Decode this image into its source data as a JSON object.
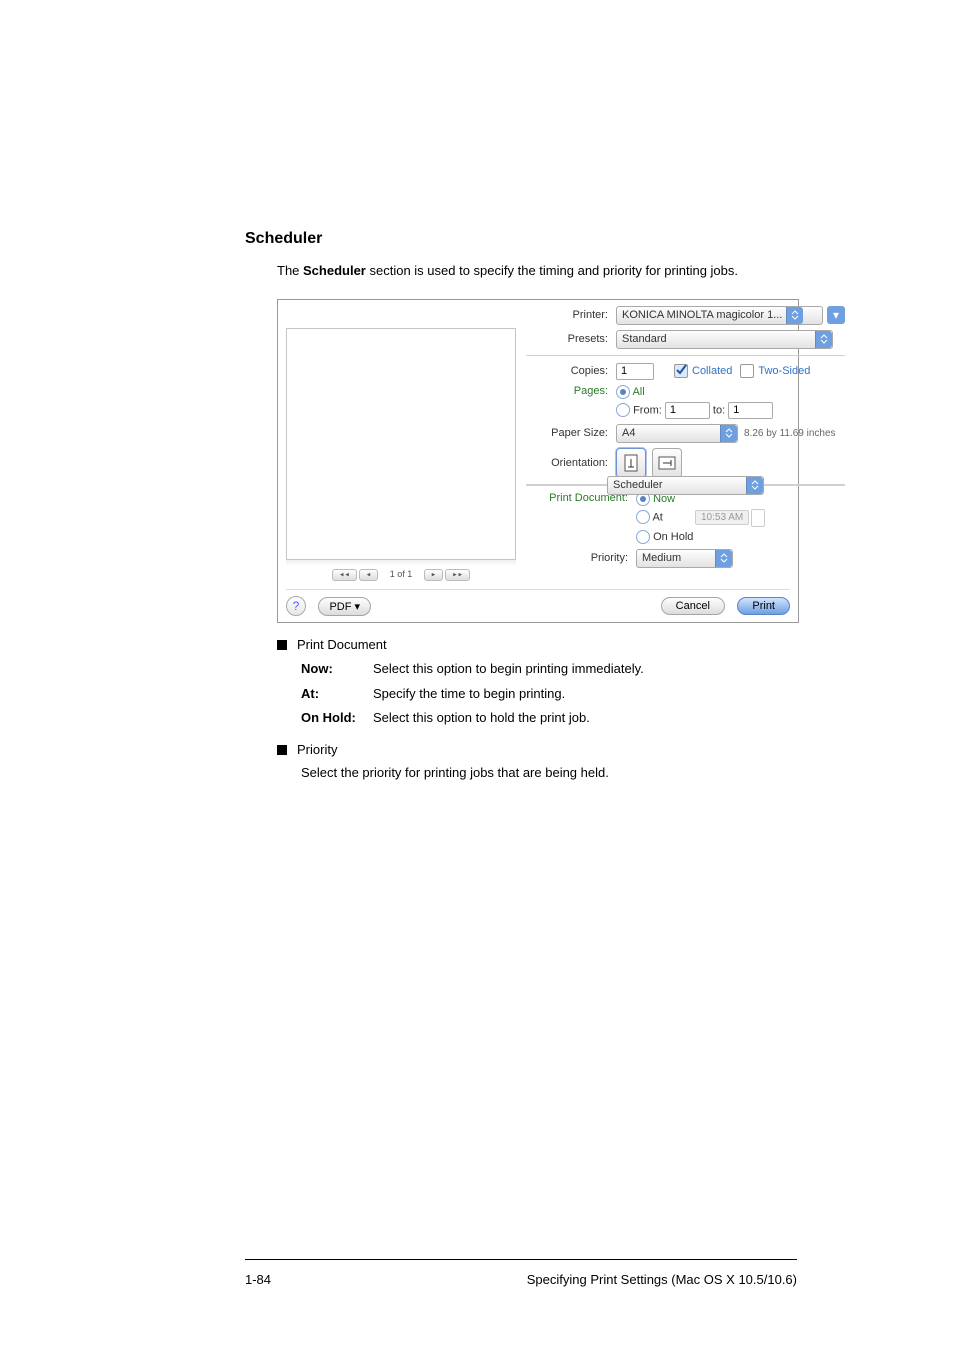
{
  "heading": "Scheduler",
  "intro": "The Scheduler section is used to specify the timing and priority for printing jobs.",
  "dialog": {
    "labels": {
      "printer": "Printer:",
      "presets": "Presets:",
      "copies": "Copies:",
      "pages": "Pages:",
      "from": "From:",
      "to": "to:",
      "papersize": "Paper Size:",
      "orientation": "Orientation:",
      "printdoc": "Print Document:",
      "priority": "Priority:"
    },
    "printer_value": "KONICA MINOLTA magicolor 1...",
    "presets_value": "Standard",
    "copies_value": "1",
    "collated_label": "Collated",
    "twosided_label": "Two-Sided",
    "pages_all": "All",
    "from_value": "1",
    "to_value": "1",
    "papersize_value": "A4",
    "papersize_dim": "8.26 by 11.69 inches",
    "section_value": "Scheduler",
    "now": "Now",
    "at": "At",
    "at_time": "10:53 AM",
    "onhold": "On Hold",
    "priority_value": "Medium",
    "nav": {
      "first": "◂◂",
      "prev": "◂",
      "page": "1 of 1",
      "next": "▸",
      "last": "▸▸"
    },
    "pdf_label": "PDF ▾",
    "cancel": "Cancel",
    "print": "Print"
  },
  "doc": {
    "printdocument_title": "Print Document",
    "now_label": "Now:",
    "now_desc": "Select this option to begin printing immediately.",
    "at_label": "At:",
    "at_desc": "Specify the time to begin printing.",
    "onhold_label": "On Hold:",
    "onhold_desc": "Select this option to hold the print job.",
    "priority_title": "Priority",
    "priority_desc": "Select the priority for printing jobs that are being held."
  },
  "footer": {
    "pagenum": "1-84",
    "title": "Specifying Print Settings (Mac OS X 10.5/10.6)"
  }
}
